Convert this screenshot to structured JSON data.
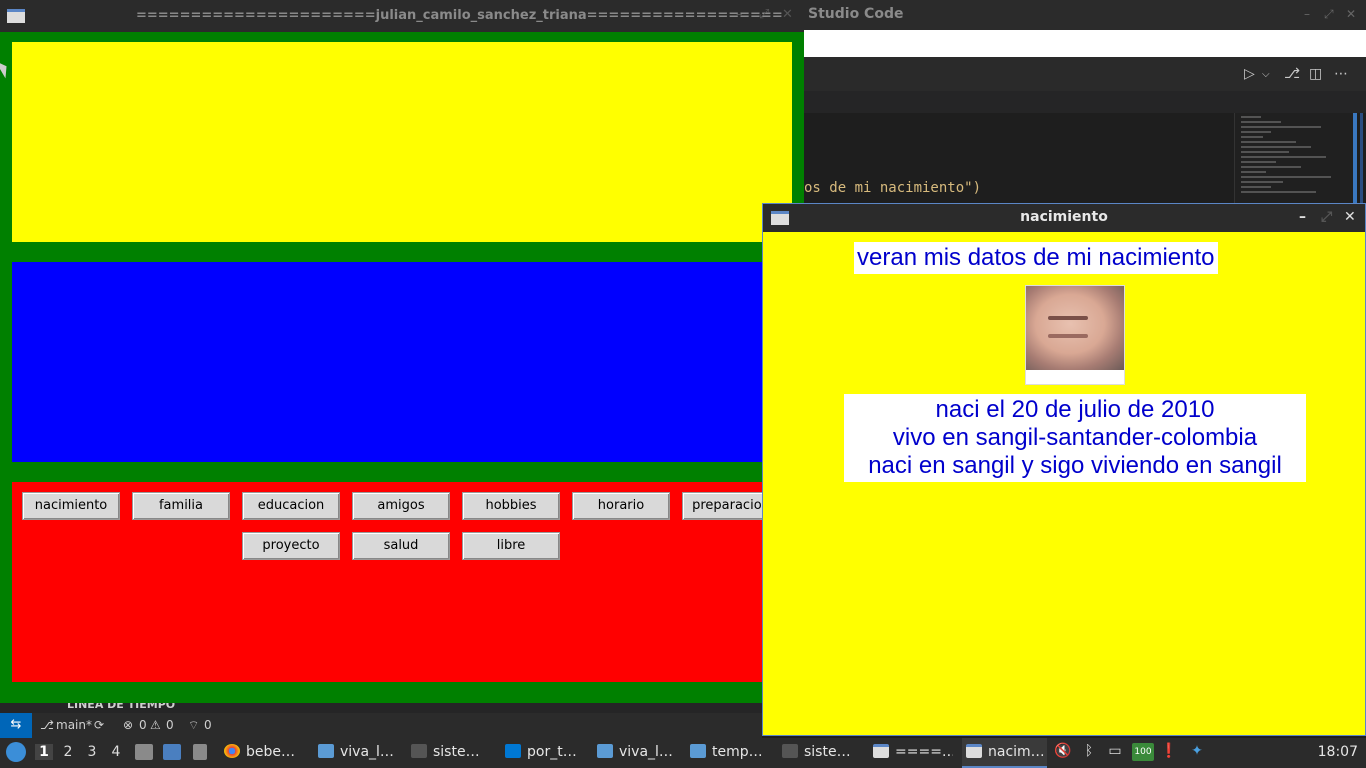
{
  "vscode": {
    "title": "Studio Code",
    "code_line": "os de mi nacimiento\")",
    "code_line2": "."
  },
  "status": {
    "timeline_label": "LÍNEA DE TIEMPO",
    "branch": "main*",
    "errors": "0",
    "warnings": "0",
    "ports": "0"
  },
  "main_window": {
    "title": "======================julian_camilo_sanchez_triana==================",
    "colors": {
      "frame": "#008000",
      "yellow": "#ffff00",
      "blue": "#0000ff",
      "red": "#ff0000"
    },
    "buttons_row1": [
      "nacimiento",
      "familia",
      "educacion",
      "amigos",
      "hobbies",
      "horario",
      "preparacion"
    ],
    "buttons_row2": [
      "proyecto",
      "salud",
      "libre"
    ]
  },
  "popup": {
    "title": "nacimiento",
    "heading": "veran mis datos de mi nacimiento",
    "info_lines": [
      "naci el 20 de julio de 2010",
      "vivo en sangil-santander-colombia",
      "naci en sangil y sigo viviendo en sangil"
    ],
    "text_color": "#0000cc"
  },
  "taskbar": {
    "workspaces": [
      "1",
      "2",
      "3",
      "4"
    ],
    "active_workspace": "1",
    "tasks": [
      {
        "label": "bebe…",
        "icon": "chrome-icon"
      },
      {
        "label": "viva_l…",
        "icon": "folder-icon"
      },
      {
        "label": "siste…",
        "icon": "terminal-icon"
      },
      {
        "label": "por_t…",
        "icon": "vscode-icon"
      },
      {
        "label": "viva_l…",
        "icon": "folder-icon"
      },
      {
        "label": "temp…",
        "icon": "folder-icon"
      },
      {
        "label": "siste…",
        "icon": "terminal-icon"
      },
      {
        "label": "====…",
        "icon": "window-icon"
      },
      {
        "label": "nacim…",
        "icon": "window-icon"
      }
    ],
    "battery_label": "100",
    "clock": "18:07"
  }
}
